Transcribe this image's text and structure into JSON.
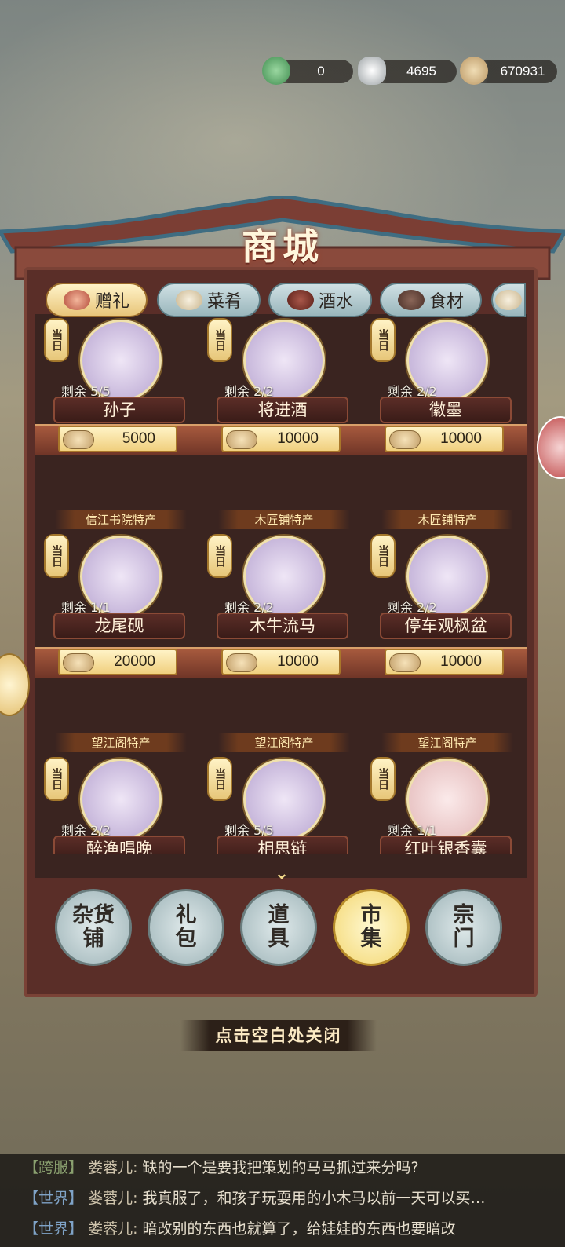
{
  "currency": {
    "jade": {
      "value": "0",
      "icon": "jade-fish-icon"
    },
    "silver": {
      "value": "4695",
      "icon": "silver-ingot-icon"
    },
    "coins": {
      "value": "670931",
      "icon": "copper-coin-icon"
    }
  },
  "shop": {
    "title": "商城"
  },
  "tabs": [
    {
      "label": "赠礼",
      "active": true
    },
    {
      "label": "菜肴"
    },
    {
      "label": "酒水"
    },
    {
      "label": "食材"
    }
  ],
  "badge_text": "当日",
  "items": [
    {
      "name": "孙子",
      "remain": "剩余 5/5",
      "price": "5000",
      "special": ""
    },
    {
      "name": "将进酒",
      "remain": "剩余 2/2",
      "price": "10000",
      "special": ""
    },
    {
      "name": "徽墨",
      "remain": "剩余 2/2",
      "price": "10000",
      "special": ""
    },
    {
      "name": "龙尾砚",
      "remain": "剩余 1/1",
      "price": "20000",
      "special": "信江书院特产"
    },
    {
      "name": "木牛流马",
      "remain": "剩余 2/2",
      "price": "10000",
      "special": "木匠铺特产"
    },
    {
      "name": "停车观枫盆",
      "remain": "剩余 2/2",
      "price": "10000",
      "special": "木匠铺特产"
    },
    {
      "name": "醉渔唱晚",
      "remain": "剩余 2/2",
      "price": "",
      "special": "望江阁特产"
    },
    {
      "name": "相思链",
      "remain": "剩余 5/5",
      "price": "",
      "special": "望江阁特产"
    },
    {
      "name": "红叶银香囊",
      "remain": "剩余 1/1",
      "price": "",
      "special": "望江阁特产"
    }
  ],
  "nav": [
    {
      "label": "杂货铺"
    },
    {
      "label": "礼包"
    },
    {
      "label": "道具"
    },
    {
      "label": "市集",
      "active": true
    },
    {
      "label": "宗门"
    }
  ],
  "close_hint": "点击空白处关闭",
  "chat": [
    {
      "channel": "【跨服】",
      "user": "娄蓉儿:",
      "message": "缺的一个是要我把策划的马马抓过来分吗?"
    },
    {
      "channel": "【世界】",
      "user": "娄蓉儿:",
      "message": "我真服了，和孩子玩耍用的小木马以前一天可以买…"
    },
    {
      "channel": "【世界】",
      "user": "娄蓉儿:",
      "message": "暗改别的东西也就算了，给娃娃的东西也要暗改"
    }
  ]
}
